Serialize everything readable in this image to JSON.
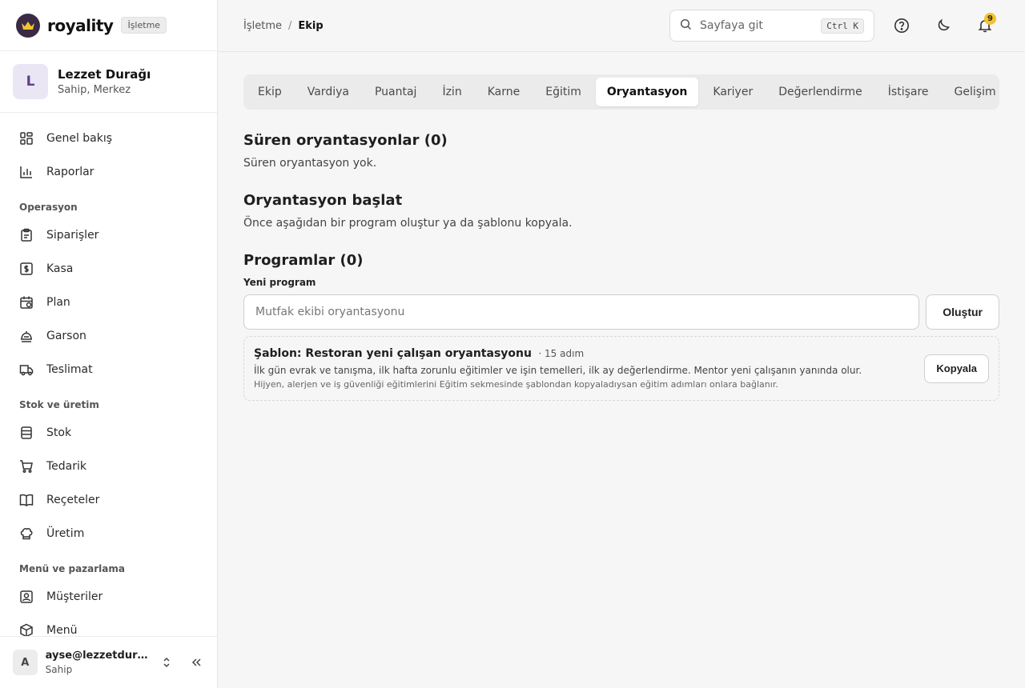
{
  "brand": {
    "name": "royality",
    "badge": "İşletme",
    "accent": "#3a2a45",
    "crown_color": "#f2c230"
  },
  "org": {
    "initial": "L",
    "name": "Lezzet Durağı",
    "subtitle": "Sahip, Merkez"
  },
  "nav": {
    "top": [
      {
        "label": "Genel bakış",
        "icon": "grid-icon"
      },
      {
        "label": "Raporlar",
        "icon": "bar-chart-icon"
      }
    ],
    "sections": [
      {
        "title": "Operasyon",
        "items": [
          {
            "label": "Siparişler",
            "icon": "clipboard-icon"
          },
          {
            "label": "Kasa",
            "icon": "cash-icon"
          },
          {
            "label": "Plan",
            "icon": "calendar-icon"
          },
          {
            "label": "Garson",
            "icon": "server-bell-icon"
          },
          {
            "label": "Teslimat",
            "icon": "truck-icon"
          }
        ]
      },
      {
        "title": "Stok ve üretim",
        "items": [
          {
            "label": "Stok",
            "icon": "database-icon"
          },
          {
            "label": "Tedarik",
            "icon": "cart-icon"
          },
          {
            "label": "Reçeteler",
            "icon": "book-icon"
          },
          {
            "label": "Üretim",
            "icon": "chef-hat-icon"
          }
        ]
      },
      {
        "title": "Menü ve pazarlama",
        "items": [
          {
            "label": "Müşteriler",
            "icon": "user-card-icon"
          },
          {
            "label": "Menü",
            "icon": "box-icon"
          }
        ]
      }
    ]
  },
  "user": {
    "initial": "A",
    "email": "ayse@lezzetduragi.com",
    "role": "Sahip"
  },
  "breadcrumb": {
    "root": "İşletme",
    "separator": "/",
    "current": "Ekip"
  },
  "search": {
    "placeholder": "Sayfaya git",
    "shortcut": "Ctrl K"
  },
  "notifications": {
    "count": "9"
  },
  "tabs": [
    "Ekip",
    "Vardiya",
    "Puantaj",
    "İzin",
    "Karne",
    "Eğitim",
    "Oryantasyon",
    "Kariyer",
    "Değerlendirme",
    "İstişare",
    "Gelişim raporu"
  ],
  "active_tab": "Oryantasyon",
  "ongoing": {
    "title": "Süren oryantasyonlar (0)",
    "empty": "Süren oryantasyon yok."
  },
  "start": {
    "title": "Oryantasyon başlat",
    "hint": "Önce aşağıdan bir program oluştur ya da şablonu kopyala."
  },
  "programs": {
    "title": "Programlar (0)",
    "new_label": "Yeni program",
    "new_placeholder": "Mutfak ekibi oryantasyonu",
    "create_label": "Oluştur"
  },
  "template": {
    "title": "Şablon: Restoran yeni çalışan oryantasyonu",
    "steps": "· 15 adım",
    "description": "İlk gün evrak ve tanışma, ilk hafta zorunlu eğitimler ve işin temelleri, ilk ay değerlendirme. Mentor yeni çalışanın yanında olur.",
    "note": "Hijyen, alerjen ve iş güvenliği eğitimlerini Eğitim sekmesinde şablondan kopyaladıysan eğitim adımları onlara bağlanır.",
    "copy_label": "Kopyala"
  }
}
